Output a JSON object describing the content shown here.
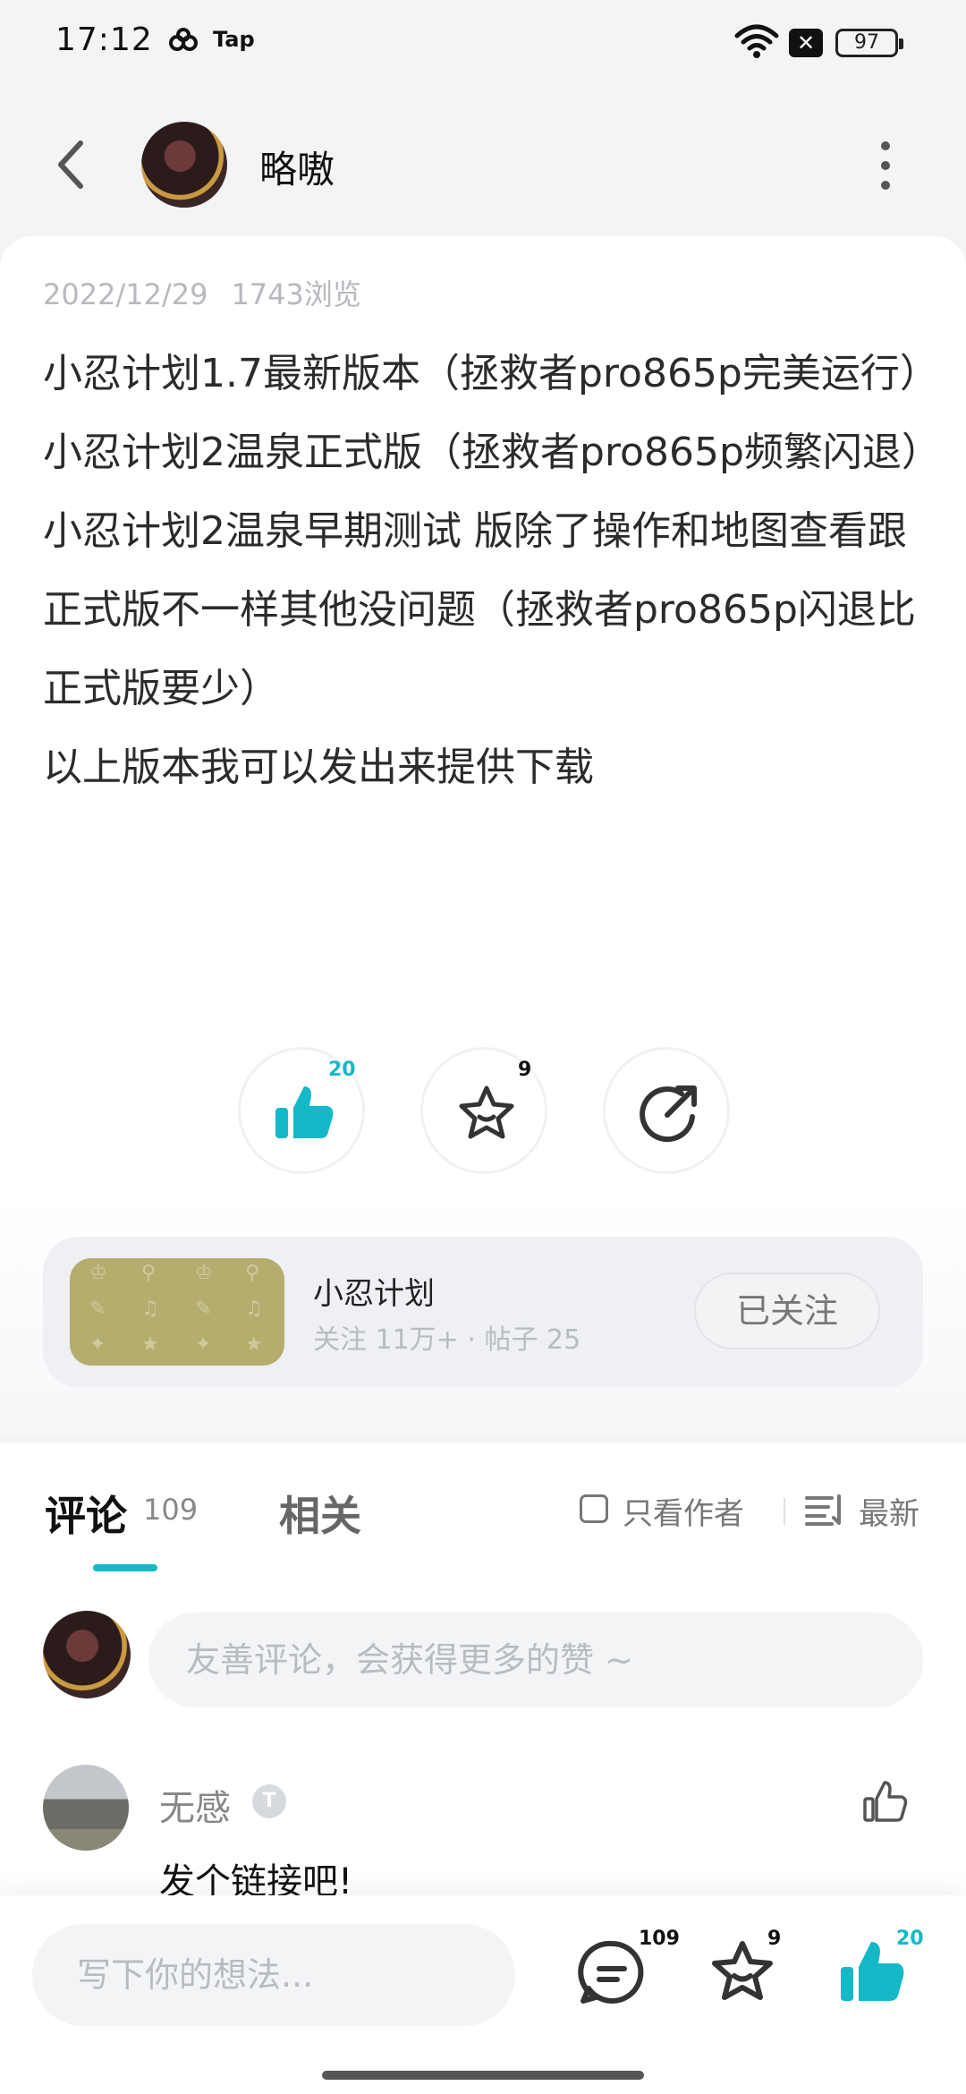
{
  "status_bar": {
    "time": "17:12",
    "app_label": "Tap",
    "battery": "97",
    "notification_glyph": "✕"
  },
  "header": {
    "author_name": "略嗷"
  },
  "post": {
    "date": "2022/12/29",
    "views": "1743浏览",
    "paragraphs": [
      "小忍计划1.7最新版本（拯救者pro865p完美运行）",
      "小忍计划2温泉正式版（拯救者pro865p频繁闪退）",
      "小忍计划2温泉早期测试 版除了操作和地图查看跟正式版不一样其他没问题（拯救者pro865p闪退比正式版要少）",
      "以上版本我可以发出来提供下载"
    ]
  },
  "actions": {
    "like_count": "20",
    "favorite_count": "9"
  },
  "game": {
    "title": "小忍计划",
    "stats": "关注 11万+ · 帖子 25",
    "follow_label": "已关注"
  },
  "tabs": {
    "comments_label": "评论",
    "comments_count": "109",
    "related_label": "相关",
    "author_only_label": "只看作者",
    "sort_label": "最新"
  },
  "comment_input_placeholder": "友善评论，会获得更多的赞 ~",
  "comments": [
    {
      "user": "无感",
      "badge": "T",
      "text": "发个链接吧!"
    }
  ],
  "bottom_bar": {
    "placeholder": "写下你的想法...",
    "comment_count": "109",
    "favorite_count": "9",
    "like_count": "20"
  },
  "colors": {
    "accent": "#14b9c8",
    "text_dark": "#2b2b2b",
    "muted": "#b6b9bf"
  }
}
